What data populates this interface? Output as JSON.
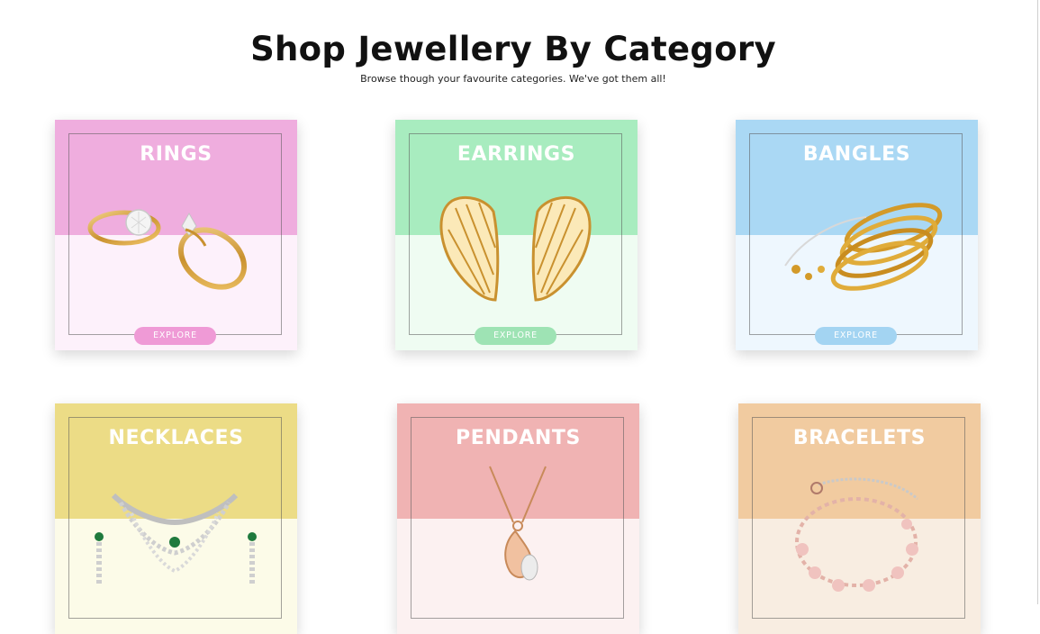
{
  "header": {
    "title": "Shop Jewellery By Category",
    "subtitle": "Browse though your favourite categories. We've got them all!"
  },
  "categories": [
    {
      "name": "RINGS",
      "button": "EXPLORE",
      "top_color": "#efadde",
      "bottom_color": "#fdf1fb",
      "button_color": "#ef9ad6",
      "image_icon": "rings-icon"
    },
    {
      "name": "EARRINGS",
      "button": "EXPLORE",
      "top_color": "#a8ecbf",
      "bottom_color": "#effcf2",
      "button_color": "#9ee3b4",
      "image_icon": "earrings-icon"
    },
    {
      "name": "BANGLES",
      "button": "EXPLORE",
      "top_color": "#aad8f4",
      "bottom_color": "#eef7fe",
      "button_color": "#a3d4f2",
      "image_icon": "bangles-icon"
    },
    {
      "name": "NECKLACES",
      "button": "",
      "top_color": "#ecdc86",
      "bottom_color": "#fcfbe8",
      "button_color": "#e7d47a",
      "image_icon": "necklace-icon"
    },
    {
      "name": "PENDANTS",
      "button": "",
      "top_color": "#f0b3b3",
      "bottom_color": "#fcf1f1",
      "button_color": "#eba9a9",
      "image_icon": "pendant-icon"
    },
    {
      "name": "BRACELETS",
      "button": "",
      "top_color": "#f1cba0",
      "bottom_color": "#f8ede1",
      "button_color": "#edc18e",
      "image_icon": "bracelet-icon"
    }
  ]
}
